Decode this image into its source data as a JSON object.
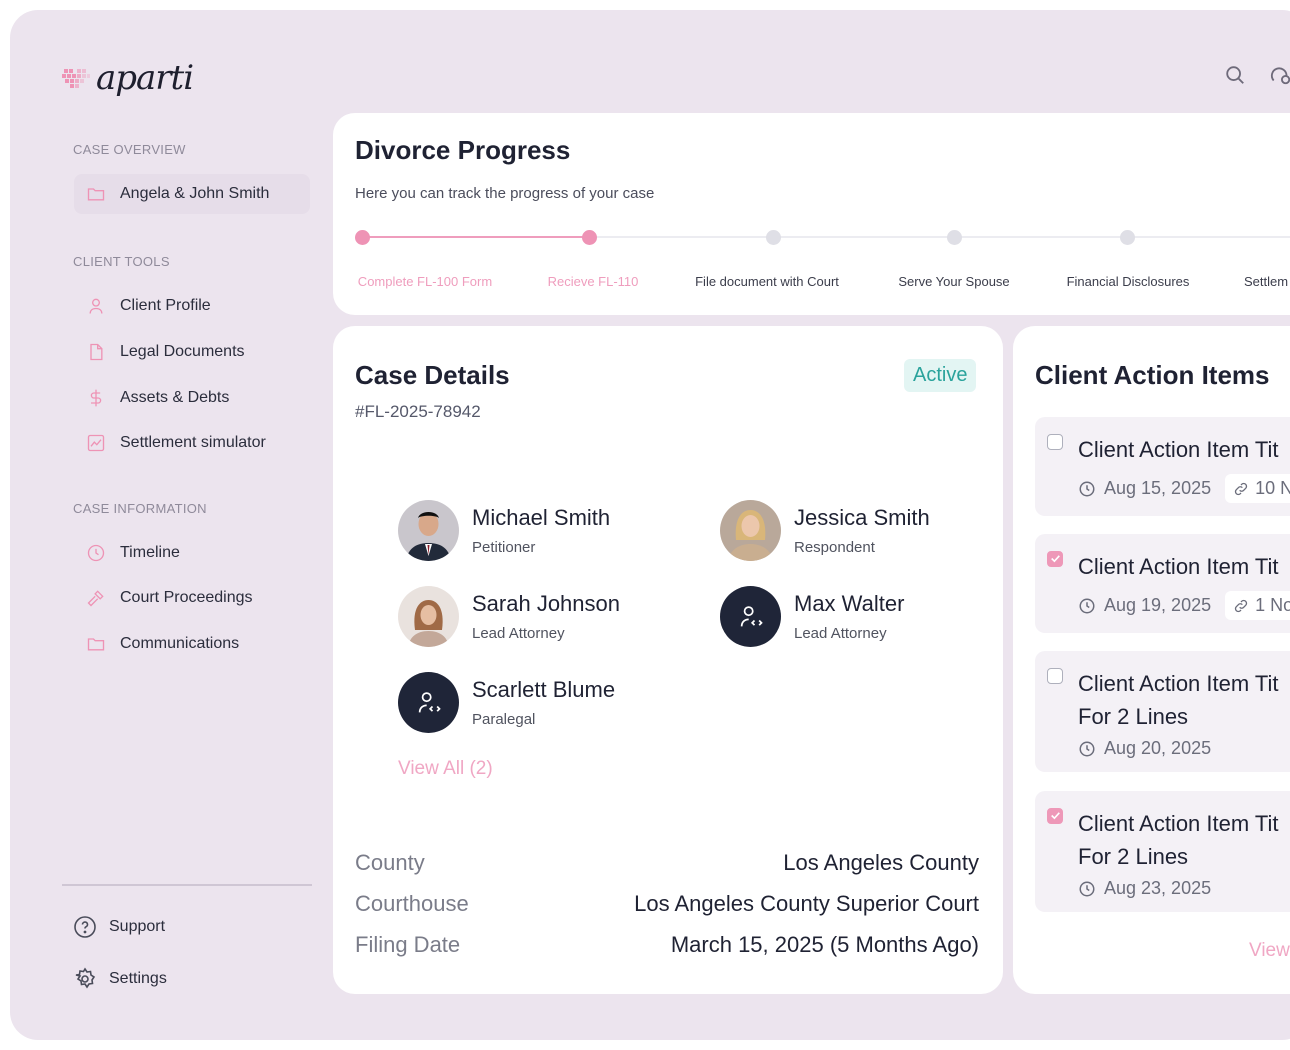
{
  "brand": {
    "name": "aparti"
  },
  "sidebar": {
    "sections": [
      {
        "heading": "CASE OVERVIEW",
        "items": [
          {
            "label": "Angela & John Smith",
            "icon": "folder-icon"
          }
        ]
      },
      {
        "heading": "CLIENT TOOLS",
        "items": [
          {
            "label": "Client Profile",
            "icon": "user-icon"
          },
          {
            "label": "Legal Documents",
            "icon": "document-icon"
          },
          {
            "label": "Assets & Debts",
            "icon": "dollar-icon"
          },
          {
            "label": "Settlement simulator",
            "icon": "chart-icon"
          }
        ]
      },
      {
        "heading": "CASE INFORMATION",
        "items": [
          {
            "label": "Timeline",
            "icon": "clock-icon"
          },
          {
            "label": "Court Proceedings",
            "icon": "gavel-icon"
          },
          {
            "label": "Communications",
            "icon": "folder-icon"
          }
        ]
      }
    ],
    "footer": [
      {
        "label": "Support",
        "icon": "help-icon"
      },
      {
        "label": "Settings",
        "icon": "gear-icon"
      }
    ]
  },
  "progress": {
    "title": "Divorce Progress",
    "subtitle": "Here you can track the progress of your case",
    "steps": [
      {
        "label": "Complete FL-100 Form",
        "done": true
      },
      {
        "label": "Recieve FL-110",
        "done": true
      },
      {
        "label": "File document with Court",
        "done": false
      },
      {
        "label": "Serve Your Spouse",
        "done": false
      },
      {
        "label": "Financial Disclosures",
        "done": false
      },
      {
        "label": "Settlem",
        "done": false
      }
    ]
  },
  "case_details": {
    "title": "Case Details",
    "case_number": "#FL-2025-78942",
    "status": "Active",
    "people": [
      {
        "name": "Michael Smith",
        "role": "Petitioner",
        "avatar": "photo"
      },
      {
        "name": "Jessica Smith",
        "role": "Respondent",
        "avatar": "photo"
      },
      {
        "name": "Sarah Johnson",
        "role": "Lead Attorney",
        "avatar": "photo"
      },
      {
        "name": "Max Walter",
        "role": "Lead Attorney",
        "avatar": "placeholder"
      },
      {
        "name": "Scarlett Blume",
        "role": "Paralegal",
        "avatar": "placeholder"
      }
    ],
    "view_all": "View All (2)",
    "info": [
      {
        "key": "County",
        "value": "Los Angeles County"
      },
      {
        "key": "Courthouse",
        "value": "Los Angeles County Superior Court"
      },
      {
        "key": "Filing Date",
        "value": "March 15, 2025 (5 Months Ago)"
      }
    ]
  },
  "action_items": {
    "title": "Client Action Items",
    "items": [
      {
        "title": "Client Action Item Tit",
        "title2": "",
        "date": "Aug 15, 2025",
        "link": "10 N",
        "checked": false
      },
      {
        "title": "Client Action Item Tit",
        "title2": "",
        "date": "Aug 19, 2025",
        "link": "1 No",
        "checked": true
      },
      {
        "title": "Client Action Item Tit",
        "title2": "For 2 Lines",
        "date": "Aug 20, 2025",
        "link": "",
        "checked": false
      },
      {
        "title": "Client Action Item Tit",
        "title2": "For 2 Lines",
        "date": "Aug 23, 2025",
        "link": "",
        "checked": true
      }
    ],
    "view_more": "View"
  },
  "colors": {
    "accent": "#ee93b5",
    "bg": "#ece4ee",
    "dark": "#1f2538",
    "success": "#2aa39c"
  }
}
